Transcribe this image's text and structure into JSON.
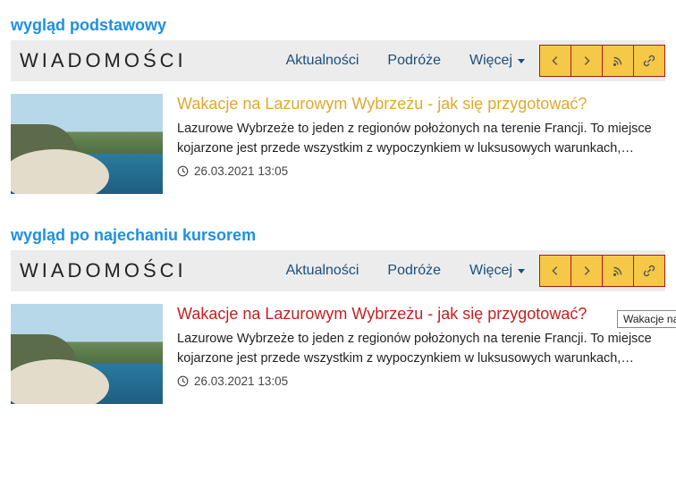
{
  "states": [
    {
      "key": "default",
      "label": "wygląd podstawowy",
      "hover": false
    },
    {
      "key": "hover",
      "label": "wygląd po najechaniu kursorem",
      "hover": true
    }
  ],
  "header": {
    "brand": "WIADOMOŚCI",
    "nav": [
      {
        "label": "Aktualności"
      },
      {
        "label": "Podróże"
      },
      {
        "label": "Więcej",
        "dropdown": true
      }
    ],
    "icons": [
      "chevron-left",
      "chevron-right",
      "rss",
      "link"
    ]
  },
  "article": {
    "title": "Wakacje na Lazurowym Wybrzeżu - jak się przygotować?",
    "excerpt": "Lazurowe Wybrzeże to jeden z regionów położonych na terenie Francji. To miejsce kojarzone jest przede wszystkim z wypoczynkiem w luksusowych warunkach,…",
    "date": "26.03.2021 13:05",
    "tooltip": "Wakacje na Lazurov"
  }
}
